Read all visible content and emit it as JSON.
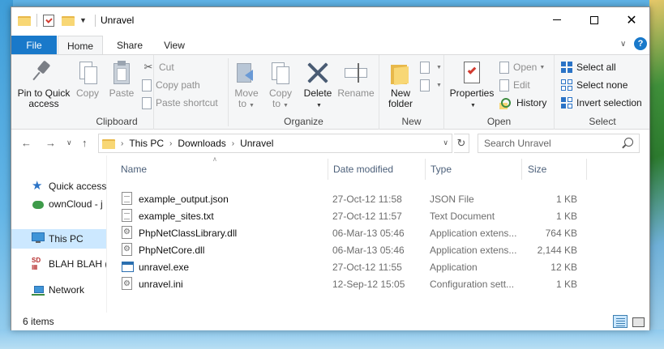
{
  "window": {
    "title": "Unravel",
    "controls": {
      "minimize": "minimize",
      "maximize": "maximize",
      "close": "✕"
    }
  },
  "ribbon_tabs": [
    {
      "label": "File"
    },
    {
      "label": "Home"
    },
    {
      "label": "Share"
    },
    {
      "label": "View"
    }
  ],
  "ribbon": {
    "clipboard": {
      "label": "Clipboard",
      "pin_label_1": "Pin to Quick",
      "pin_label_2": "access",
      "copy": "Copy",
      "paste": "Paste",
      "cut": "Cut",
      "copy_path": "Copy path",
      "paste_shortcut": "Paste shortcut"
    },
    "organize": {
      "label": "Organize",
      "move_to_1": "Move",
      "move_to_2": "to",
      "copy_to_1": "Copy",
      "copy_to_2": "to",
      "delete": "Delete",
      "rename": "Rename"
    },
    "new": {
      "label": "New",
      "new_folder_1": "New",
      "new_folder_2": "folder"
    },
    "open": {
      "label": "Open",
      "properties": "Properties",
      "open": "Open",
      "edit": "Edit",
      "history": "History"
    },
    "select": {
      "label": "Select",
      "select_all": "Select all",
      "select_none": "Select none",
      "invert_selection": "Invert selection"
    }
  },
  "address": {
    "crumbs": [
      "This PC",
      "Downloads",
      "Unravel"
    ],
    "search_placeholder": "Search Unravel"
  },
  "nav_pane": {
    "items": [
      {
        "label": "Quick access",
        "icon": "star-icon"
      },
      {
        "label": "ownCloud - j",
        "icon": "cloud-icon"
      },
      {
        "label": "This PC",
        "icon": "computer-icon",
        "selected": true
      },
      {
        "label": "BLAH BLAH (",
        "icon": "sd-card-icon"
      },
      {
        "label": "Network",
        "icon": "network-icon"
      }
    ]
  },
  "columns": {
    "name": "Name",
    "date_modified": "Date modified",
    "type": "Type",
    "size": "Size"
  },
  "files": [
    {
      "name": "example_output.json",
      "date": "27-Oct-12 11:58",
      "type": "JSON File",
      "size": "1 KB",
      "icon": "text-file-icon"
    },
    {
      "name": "example_sites.txt",
      "date": "27-Oct-12 11:57",
      "type": "Text Document",
      "size": "1 KB",
      "icon": "text-file-icon"
    },
    {
      "name": "PhpNetClassLibrary.dll",
      "date": "06-Mar-13 05:46",
      "type": "Application extens...",
      "size": "764 KB",
      "icon": "dll-file-icon"
    },
    {
      "name": "PhpNetCore.dll",
      "date": "06-Mar-13 05:46",
      "type": "Application extens...",
      "size": "2,144 KB",
      "icon": "dll-file-icon"
    },
    {
      "name": "unravel.exe",
      "date": "27-Oct-12 11:55",
      "type": "Application",
      "size": "12 KB",
      "icon": "exe-file-icon"
    },
    {
      "name": "unravel.ini",
      "date": "12-Sep-12 15:05",
      "type": "Configuration sett...",
      "size": "1 KB",
      "icon": "ini-file-icon"
    }
  ],
  "status": {
    "item_count": "6 items"
  },
  "colors": {
    "accent": "#1979ca",
    "selection": "#cce8ff",
    "header_text": "#4c607a"
  }
}
